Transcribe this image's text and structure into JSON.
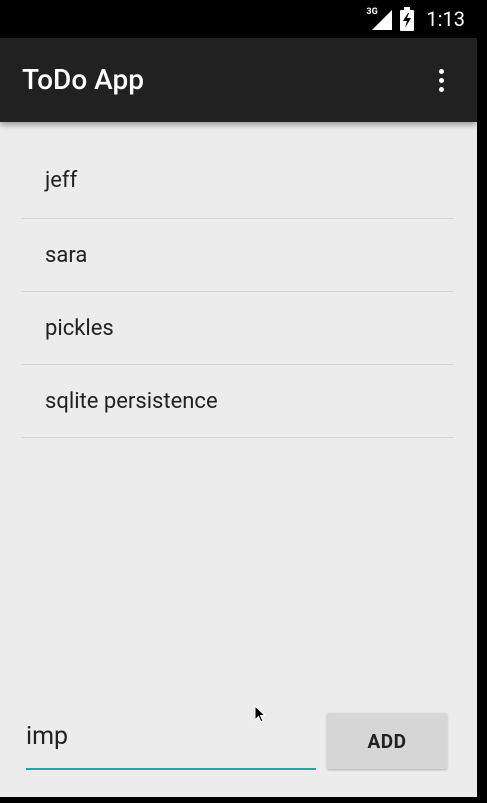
{
  "status_bar": {
    "network_type": "3G",
    "time": "1:13",
    "signal_icon": "cell-signal-icon",
    "battery_icon": "battery-charging-icon"
  },
  "app_bar": {
    "title": "ToDo App",
    "overflow_icon": "more-vertical-icon"
  },
  "todo_list": {
    "items": [
      {
        "label": "jeff"
      },
      {
        "label": "sara"
      },
      {
        "label": "pickles"
      },
      {
        "label": "sqlite persistence"
      }
    ]
  },
  "new_item": {
    "value": "imp",
    "add_label": "ADD"
  },
  "colors": {
    "accent": "#26a69a",
    "app_bar": "#212121",
    "background": "#ececec",
    "button": "#d6d6d6"
  }
}
